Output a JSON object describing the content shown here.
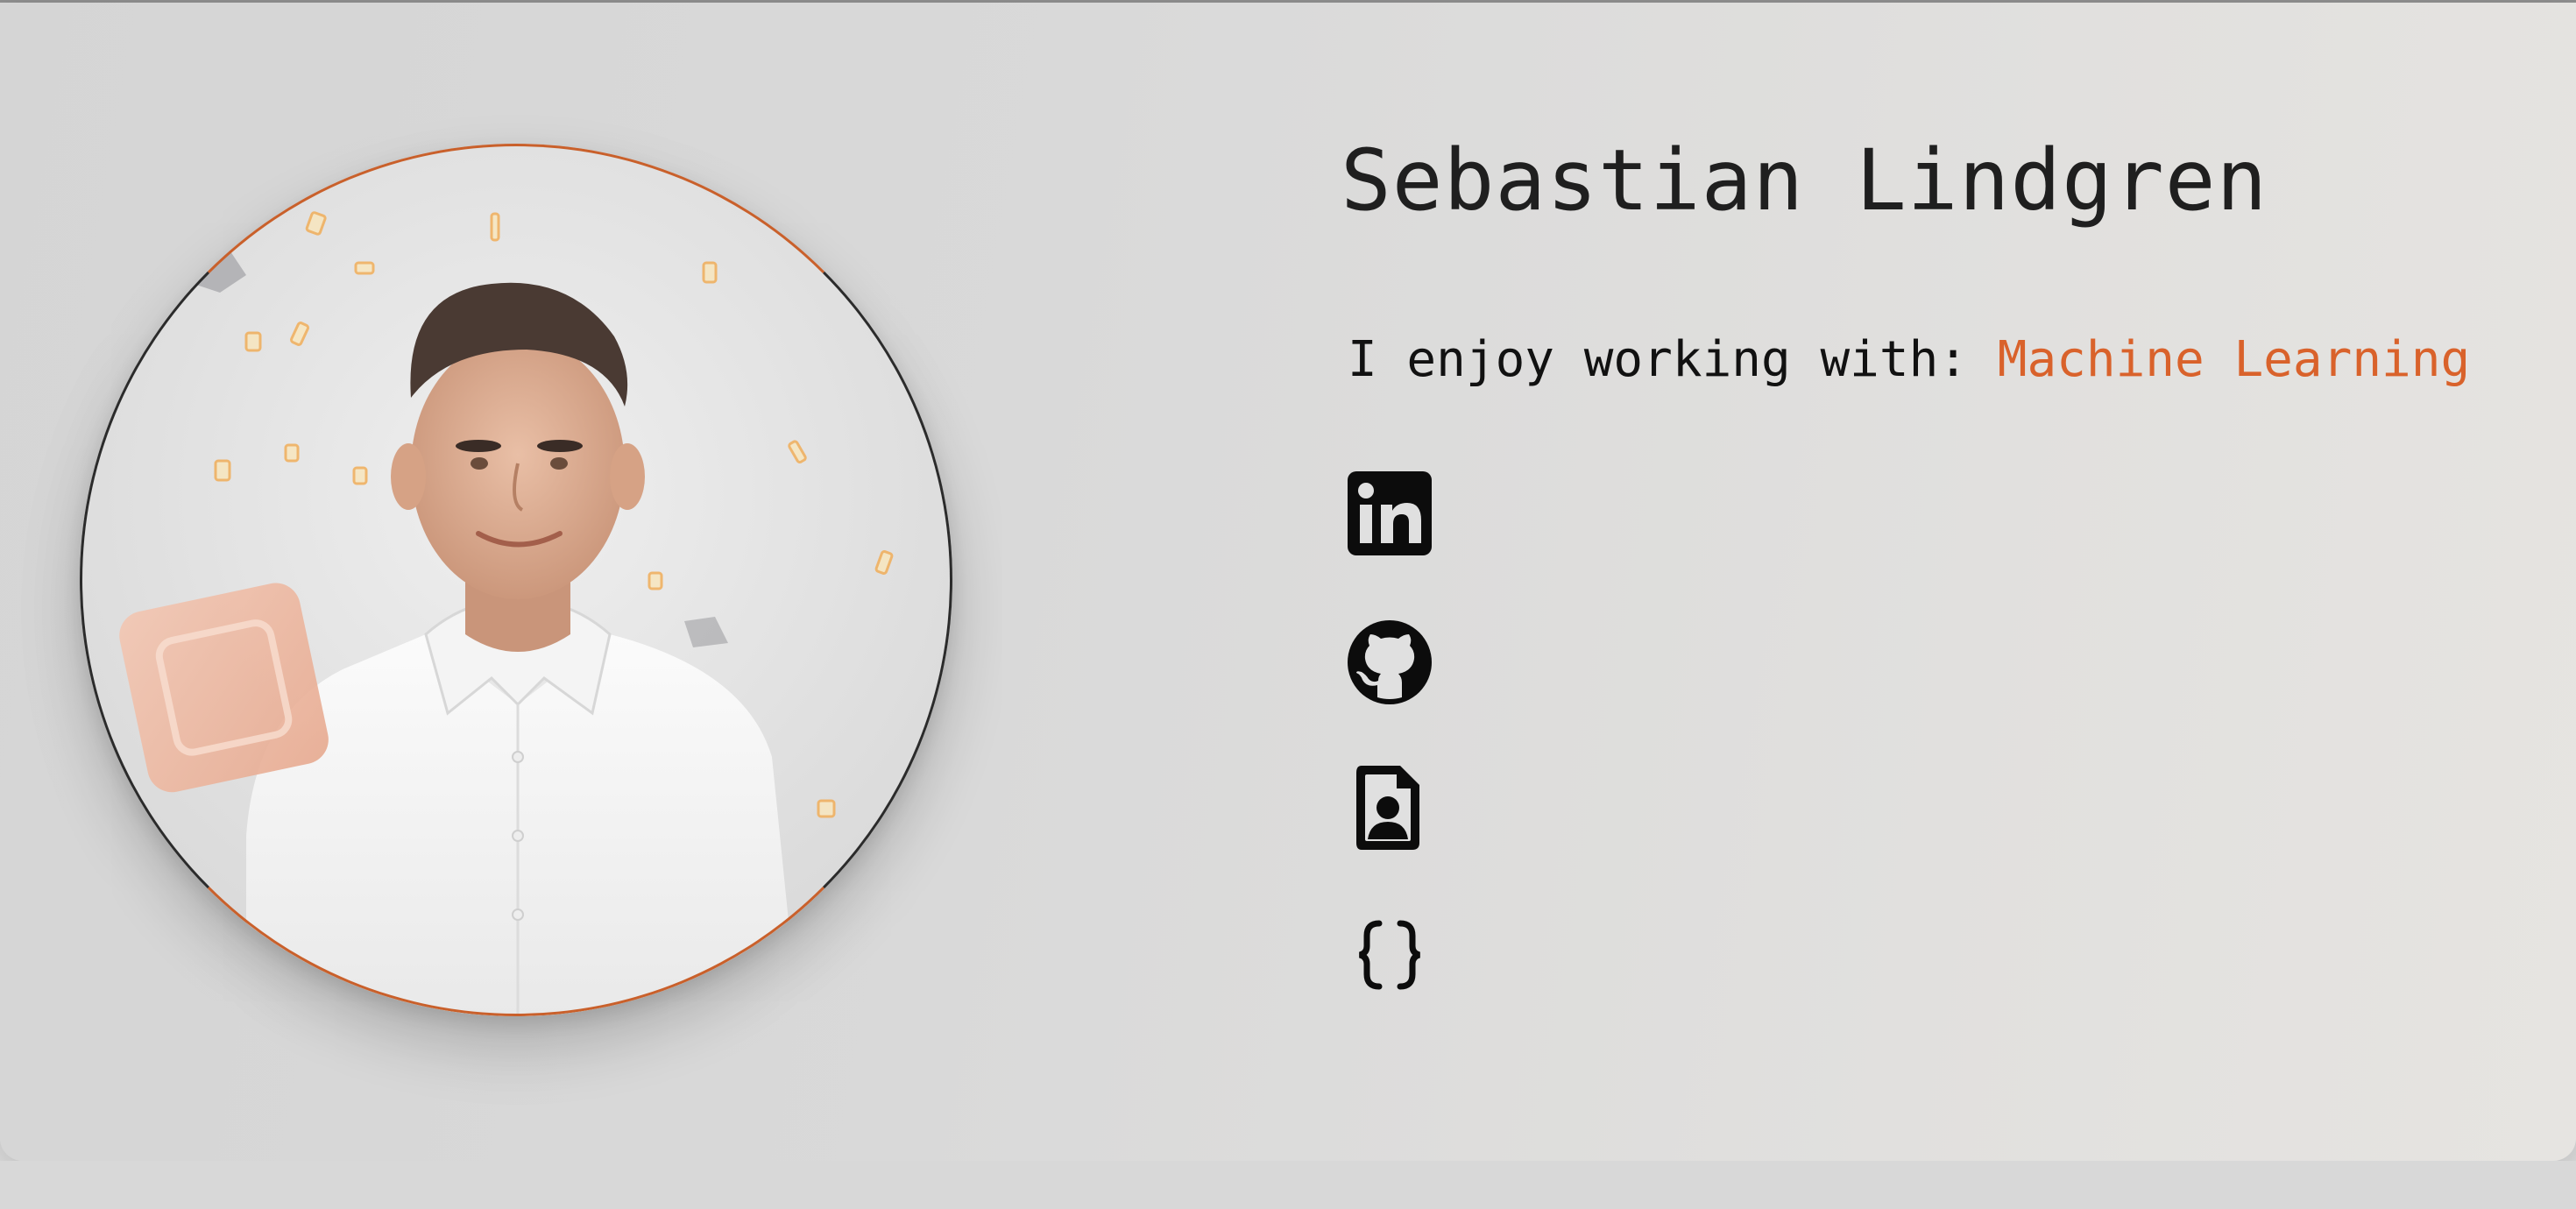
{
  "profile": {
    "name": "Sebastian Lindgren",
    "enjoy_prefix": "I enjoy working with: ",
    "enjoy_skill": "Machine Learning",
    "portrait_alt": "Portrait photo"
  },
  "links": [
    {
      "icon": "linkedin-icon"
    },
    {
      "icon": "github-icon"
    },
    {
      "icon": "resume-file-icon"
    },
    {
      "icon": "curly-braces-icon"
    }
  ],
  "colors": {
    "accent": "#d9622b",
    "text": "#111111",
    "background": "#d9d9d9"
  }
}
